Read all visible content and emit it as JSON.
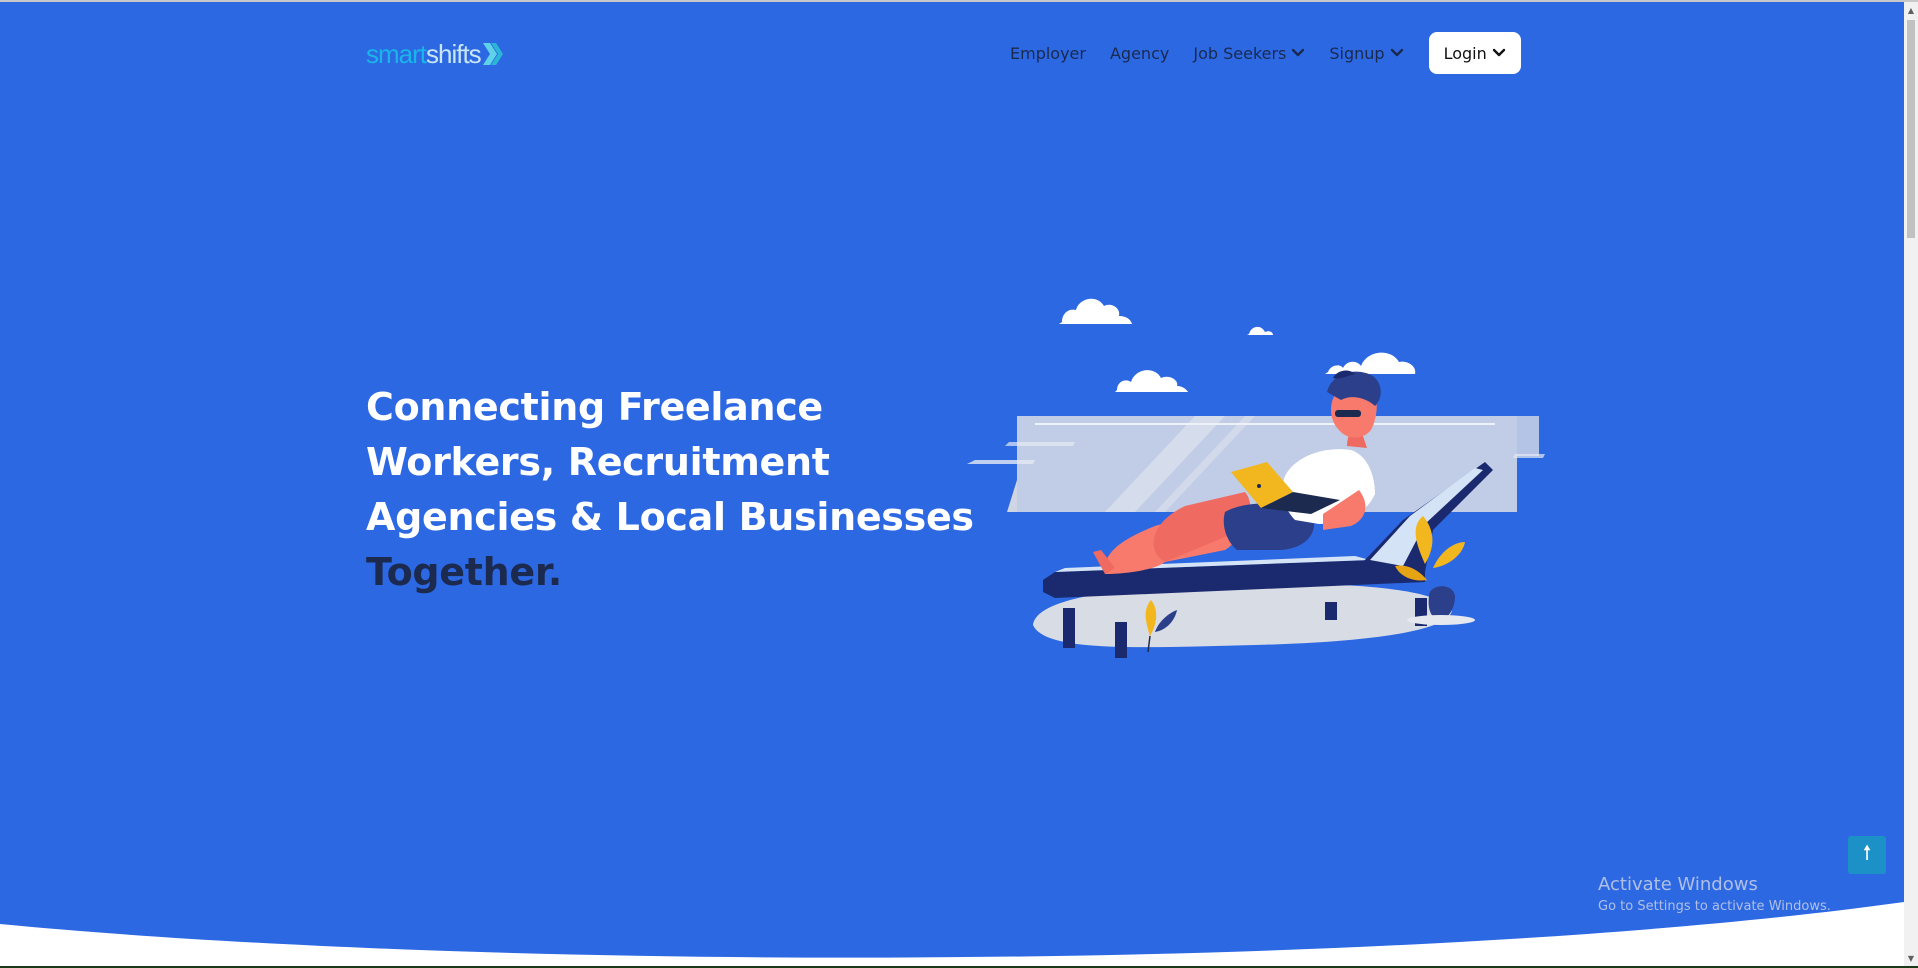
{
  "brand": {
    "logo_part1": "smart",
    "logo_part2": "shifts"
  },
  "nav": {
    "employer": "Employer",
    "agency": "Agency",
    "job_seekers": "Job Seekers",
    "signup": "Signup",
    "login": "Login"
  },
  "hero": {
    "line1": "Connecting Freelance",
    "line2": "Workers, Recruitment",
    "line3": "Agencies & Local Businesses",
    "line4": "Together."
  },
  "scroll_top_glyph": "🠕",
  "activate_windows": {
    "title": "Activate Windows",
    "subtitle": "Go to Settings to activate Windows."
  },
  "colors": {
    "background": "#2d68e3",
    "headline": "#ffffff",
    "headline_accent": "#1b2a4e",
    "nav_text": "#1a2a4f",
    "logo_smart": "#19b5e8",
    "logo_shifts": "#c9e6f5",
    "scroll_top": "#1c91c8"
  },
  "icons": {
    "logo": "double-chevron-right-icon",
    "dropdown": "chevron-down-icon",
    "scroll_top": "arrow-up-icon"
  }
}
